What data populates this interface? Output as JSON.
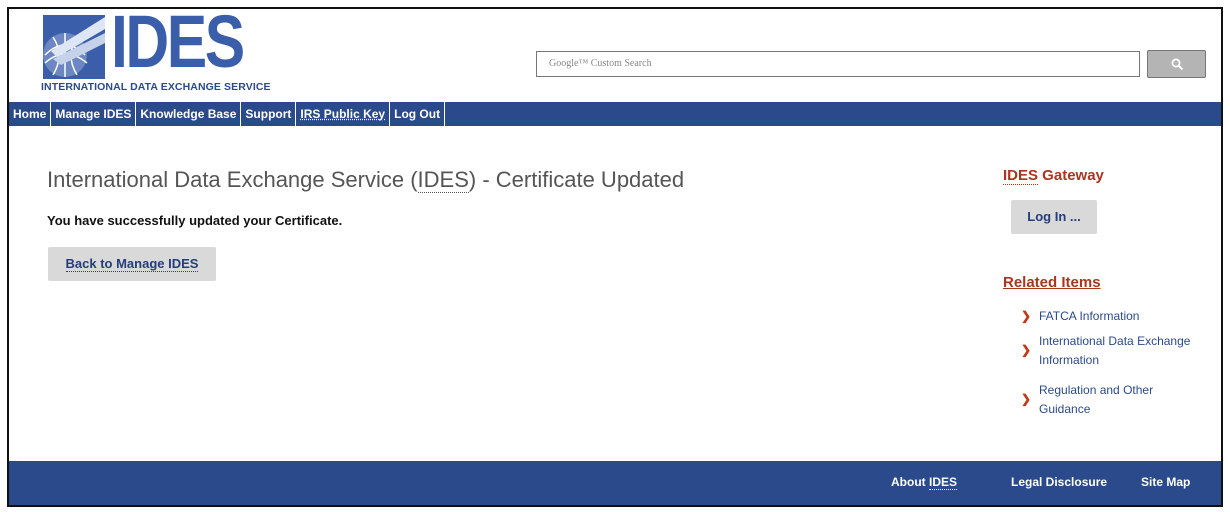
{
  "header": {
    "logo_text": "IDES",
    "logo_subtitle": "INTERNATIONAL DATA EXCHANGE SERVICE",
    "search_placeholder": "Google™ Custom Search"
  },
  "nav": {
    "items": [
      "Home",
      "Manage IDES",
      "Knowledge Base",
      "Support",
      "IRS Public Key",
      "Log Out"
    ]
  },
  "main": {
    "title_prefix": "International Data Exchange Service (",
    "title_abbr": "IDES",
    "title_suffix": ") - Certificate Updated",
    "success_message": "You have successfully updated your Certificate.",
    "back_button": "Back to Manage IDES"
  },
  "sidebar": {
    "gateway_abbr": "IDES",
    "gateway_rest": " Gateway",
    "login_button": "Log In ...",
    "related_title": "Related Items",
    "related_items": [
      "FATCA Information",
      "International Data Exchange Information",
      "Regulation and Other Guidance"
    ]
  },
  "footer": {
    "links": [
      "About IDES",
      "Legal Disclosure",
      "Site Map"
    ]
  },
  "colors": {
    "nav_blue": "#2a4a8b",
    "accent_red": "#a9361f",
    "link_blue": "#2b4a8a"
  }
}
